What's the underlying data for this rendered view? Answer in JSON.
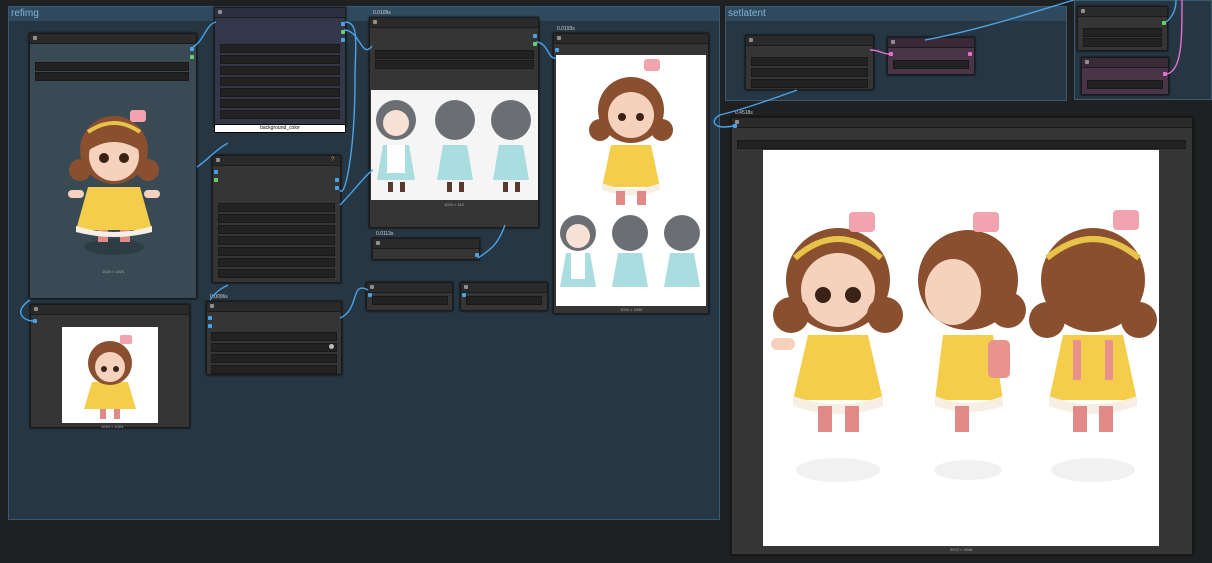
{
  "groups": {
    "refimg": "refimg",
    "setlatent": "setlatent"
  },
  "nodes": {
    "background_color_label": "background_color",
    "node_titles": [
      "0.0109s",
      "0.0006s",
      "0.0193s",
      "0.0113s",
      "0.4518s"
    ],
    "warning_icon": "?"
  },
  "captions": {
    "main_ref": "1024 × 1024",
    "small_ref": "1024 × 1024",
    "sheet_top": "1024 × 512",
    "stack": "1024 × 1536",
    "big_output": "3072 × 2048"
  },
  "colors": {
    "accent_wire": "#4aa3e8",
    "pink_wire": "#e66fd0",
    "group_bg": "#263642",
    "group_title": "#7fb3d8"
  }
}
